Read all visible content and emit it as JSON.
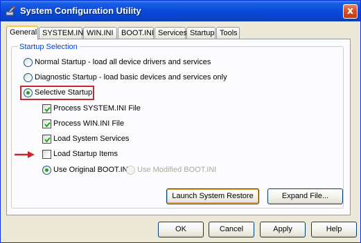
{
  "window": {
    "title": "System Configuration Utility",
    "close_label": "x"
  },
  "tabs": [
    {
      "label": "General"
    },
    {
      "label": "SYSTEM.INI"
    },
    {
      "label": "WIN.INI"
    },
    {
      "label": "BOOT.INI"
    },
    {
      "label": "Services"
    },
    {
      "label": "Startup"
    },
    {
      "label": "Tools"
    }
  ],
  "startup_selection": {
    "group_label": "Startup Selection",
    "normal": "Normal Startup - load all device drivers and services",
    "diagnostic": "Diagnostic Startup - load basic devices and services only",
    "selective": "Selective Startup",
    "selected": "selective",
    "options": [
      {
        "label": "Process SYSTEM.INI File",
        "checked": true
      },
      {
        "label": "Process WIN.INI File",
        "checked": true
      },
      {
        "label": "Load System Services",
        "checked": true
      },
      {
        "label": "Load Startup Items",
        "checked": false
      }
    ],
    "boot_original": "Use Original BOOT.INI",
    "boot_modified": "Use Modified BOOT.INI"
  },
  "panel_buttons": {
    "restore": "Launch System Restore",
    "expand": "Expand File..."
  },
  "dialog_buttons": {
    "ok": "OK",
    "cancel": "Cancel",
    "apply": "Apply",
    "help": "Help"
  },
  "colors": {
    "titlebar": "#0a4ad8",
    "highlight": "#c8252c",
    "group_label": "#0046d5"
  }
}
